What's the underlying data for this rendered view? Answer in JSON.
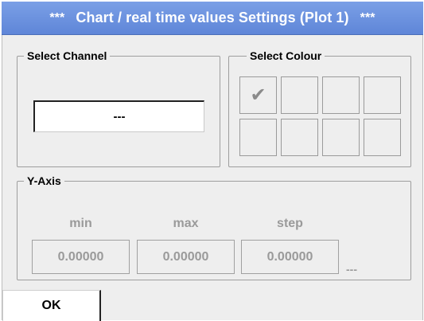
{
  "title": {
    "stars_left": "***",
    "text": "Chart / real time values Settings (Plot 1)",
    "stars_right": "***"
  },
  "select_channel": {
    "legend": "Select Channel",
    "value": "---"
  },
  "select_colour": {
    "legend": "Select Colour",
    "swatches": [
      {
        "selected": true,
        "mark": "✔"
      },
      {
        "selected": false,
        "mark": ""
      },
      {
        "selected": false,
        "mark": ""
      },
      {
        "selected": false,
        "mark": ""
      },
      {
        "selected": false,
        "mark": ""
      },
      {
        "selected": false,
        "mark": ""
      },
      {
        "selected": false,
        "mark": ""
      },
      {
        "selected": false,
        "mark": ""
      }
    ]
  },
  "y_axis": {
    "legend": "Y-Axis",
    "min_label": "min",
    "max_label": "max",
    "step_label": "step",
    "min_value": "0.00000",
    "max_value": "0.00000",
    "step_value": "0.00000",
    "unit": "---"
  },
  "ok_label": "OK",
  "colors": {
    "title_bar": "#6a90df",
    "background": "#eeeeee",
    "disabled_text": "#9a9a9a"
  }
}
